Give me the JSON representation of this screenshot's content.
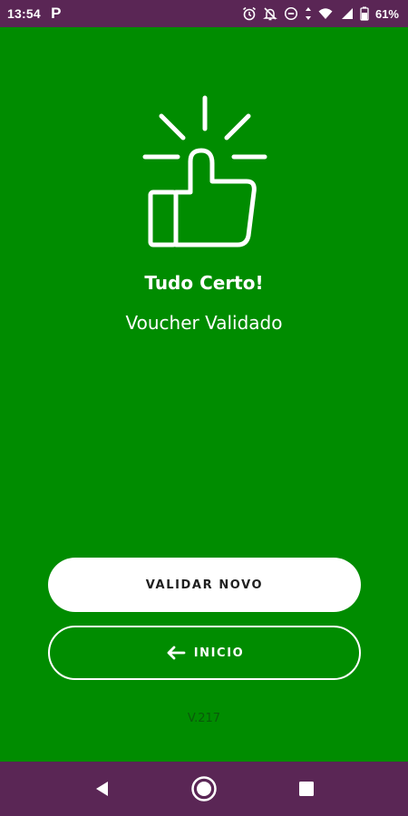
{
  "status_bar": {
    "time": "13:54",
    "app_icon": "p-icon",
    "battery_percent": "61%",
    "icons": [
      "alarm-icon",
      "notifications-off-icon",
      "do-not-disturb-icon",
      "data-arrows-icon",
      "wifi-icon",
      "signal-icon",
      "battery-icon"
    ]
  },
  "main": {
    "icon": "thumbs-up-icon",
    "title": "Tudo Certo!",
    "subtitle": "Voucher Validado",
    "primary_button": "VALIDAR NOVO",
    "secondary_button": "INICIO",
    "secondary_button_icon": "arrow-left-icon",
    "version": "V.217"
  },
  "nav_bar": {
    "items": [
      "back-icon",
      "home-icon",
      "recents-icon"
    ]
  },
  "colors": {
    "background": "#008c00",
    "system_bars": "#5a2655",
    "button_bg": "#ffffff",
    "button_text": "#1f1f1f",
    "version_text": "#0a5a0a"
  }
}
